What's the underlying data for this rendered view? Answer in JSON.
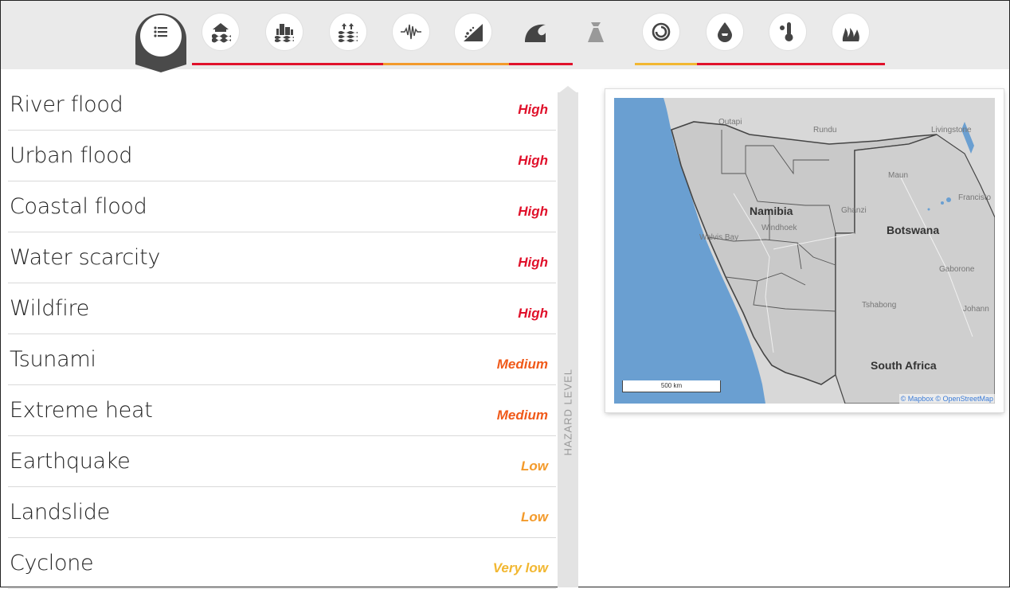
{
  "colors": {
    "high": "#e0112b",
    "medium": "#f05a1a",
    "low": "#f39a2b",
    "very_low": "#f2b731"
  },
  "nav": {
    "icons": [
      {
        "name": "list-icon",
        "active": true
      },
      {
        "name": "river-flood-icon"
      },
      {
        "name": "urban-flood-icon"
      },
      {
        "name": "coastal-flood-icon"
      },
      {
        "name": "earthquake-icon"
      },
      {
        "name": "landslide-icon"
      },
      {
        "name": "tsunami-icon"
      },
      {
        "name": "volcano-icon"
      },
      {
        "name": "cyclone-icon"
      },
      {
        "name": "water-scarcity-icon"
      },
      {
        "name": "extreme-heat-icon"
      },
      {
        "name": "wildfire-icon"
      }
    ]
  },
  "hazards": [
    {
      "name": "River flood",
      "level": "High",
      "level_key": "high"
    },
    {
      "name": "Urban flood",
      "level": "High",
      "level_key": "high"
    },
    {
      "name": "Coastal flood",
      "level": "High",
      "level_key": "high"
    },
    {
      "name": "Water scarcity",
      "level": "High",
      "level_key": "high"
    },
    {
      "name": "Wildfire",
      "level": "High",
      "level_key": "high"
    },
    {
      "name": "Tsunami",
      "level": "Medium",
      "level_key": "medium"
    },
    {
      "name": "Extreme heat",
      "level": "Medium",
      "level_key": "medium"
    },
    {
      "name": "Earthquake",
      "level": "Low",
      "level_key": "low"
    },
    {
      "name": "Landslide",
      "level": "Low",
      "level_key": "low"
    },
    {
      "name": "Cyclone",
      "level": "Very low",
      "level_key": "very_low"
    }
  ],
  "scale_label": "HAZARD LEVEL",
  "map": {
    "places": {
      "outapi": "Outapi",
      "rundu": "Rundu",
      "livingstone": "Livingstone",
      "maun": "Maun",
      "francistown": "Francisto",
      "ghanzi": "Ghanzi",
      "walvis_bay": "Walvis Bay",
      "windhoek": "Windhoek",
      "gaborone": "Gaborone",
      "tshabong": "Tshabong",
      "johannesburg": "Johann"
    },
    "countries": {
      "namibia": "Namibia",
      "botswana": "Botswana",
      "south_africa": "South Africa"
    },
    "scale_text": "500 km",
    "attribution": "© Mapbox © OpenStreetMap"
  }
}
